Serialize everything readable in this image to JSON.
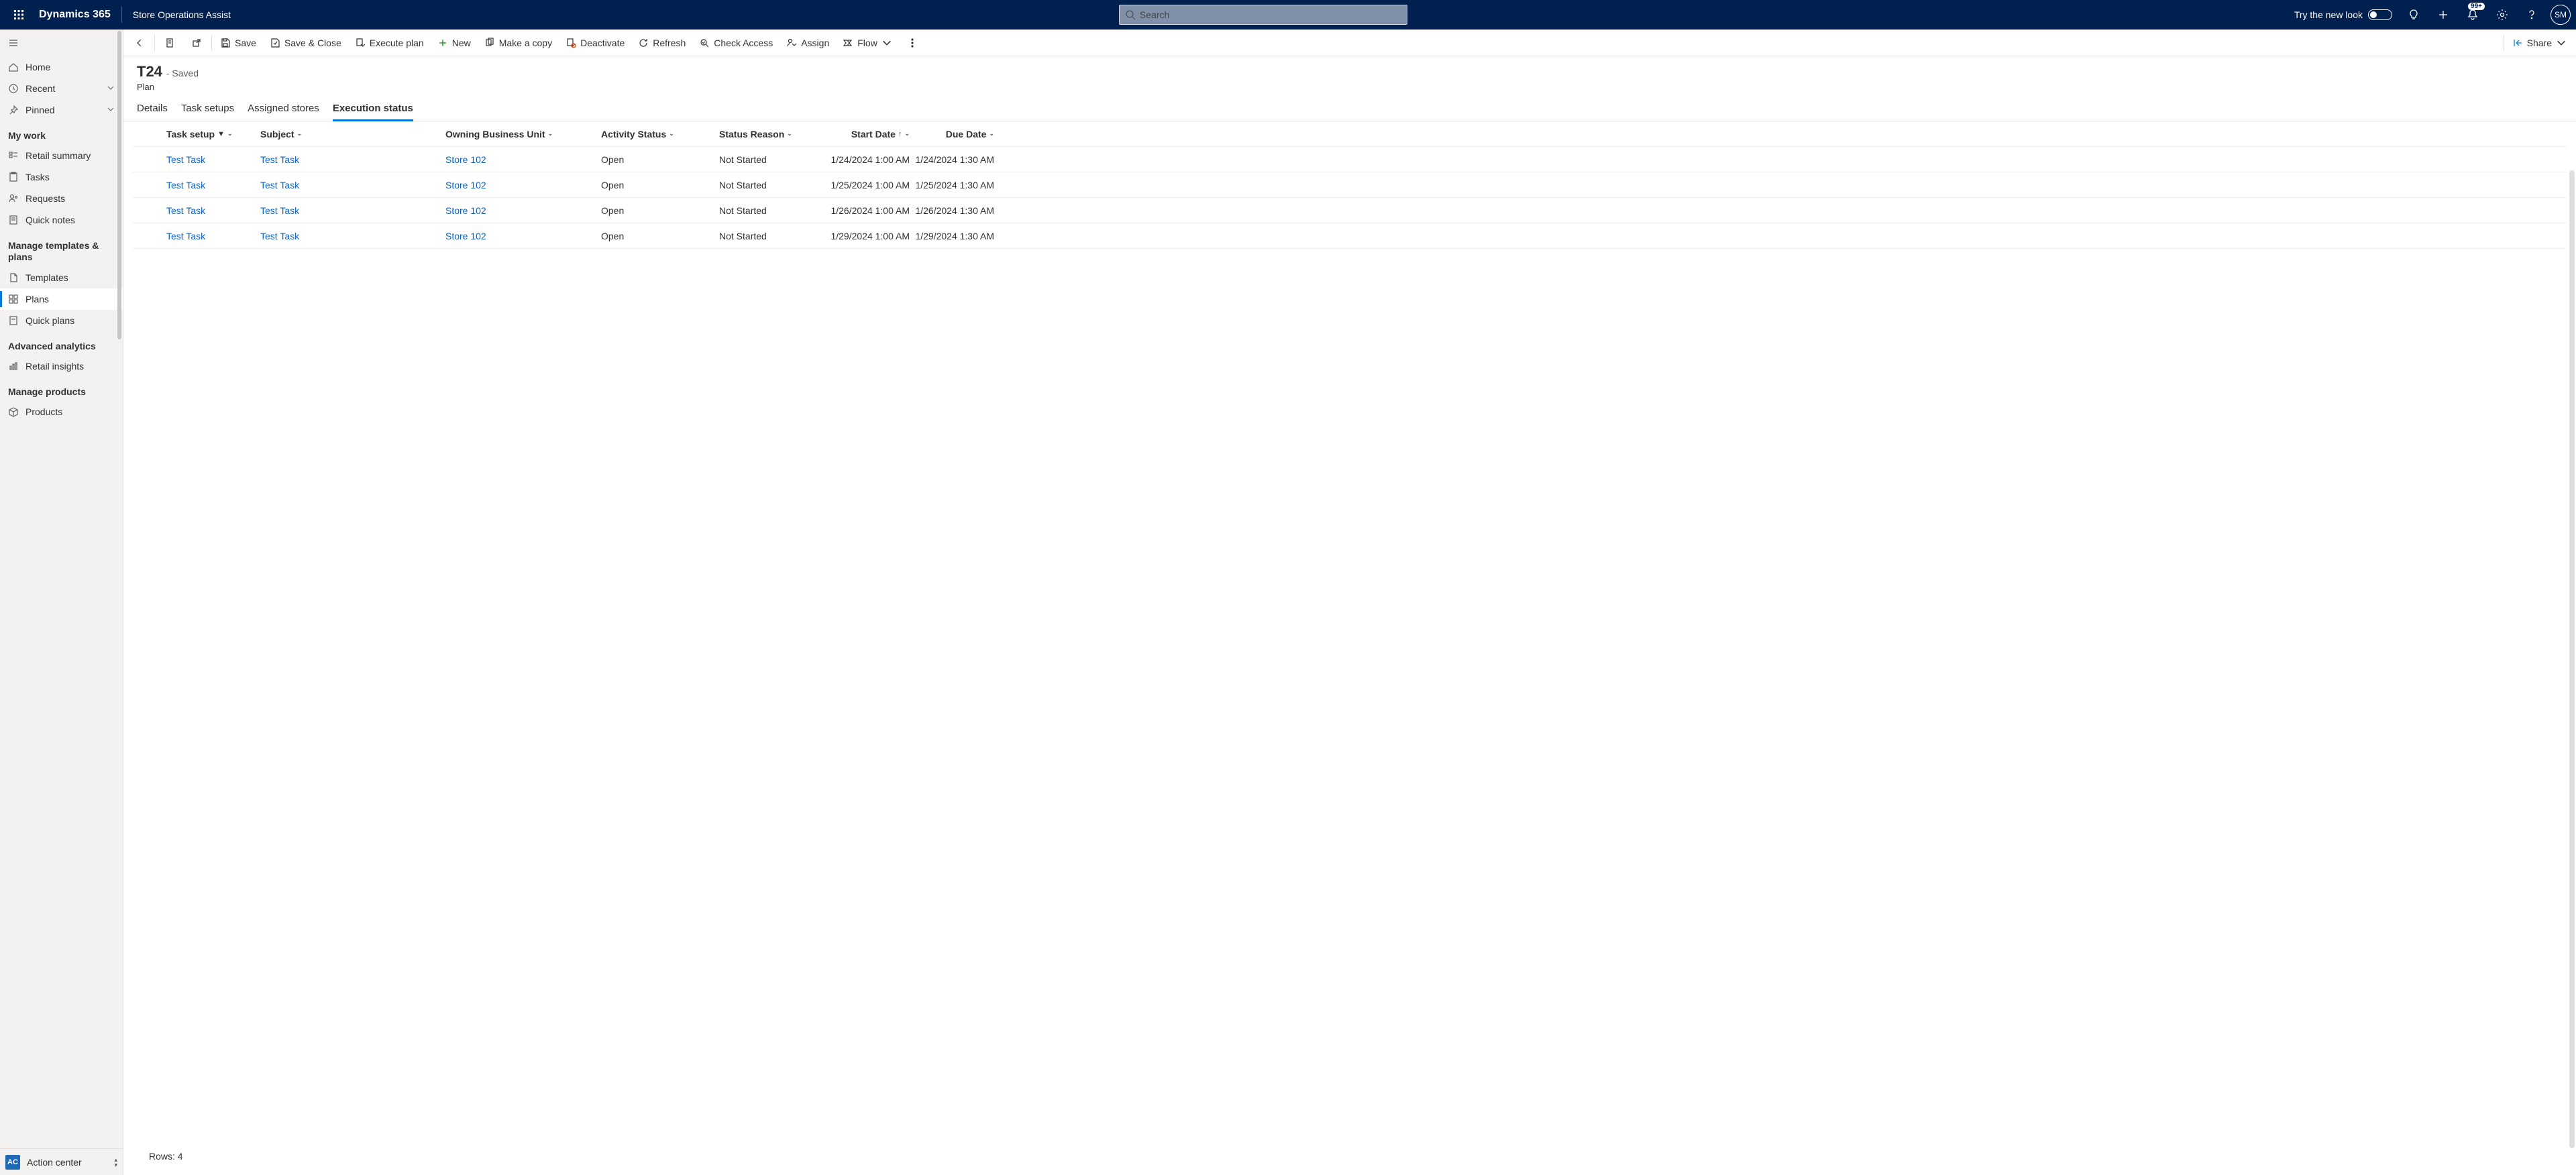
{
  "header": {
    "app_title": "Dynamics 365",
    "area_title": "Store Operations Assist",
    "search_placeholder": "Search",
    "try_new_look": "Try the new look",
    "notification_badge": "99+",
    "avatar_initials": "SM"
  },
  "sidebar": {
    "home": "Home",
    "recent": "Recent",
    "pinned": "Pinned",
    "sections": {
      "my_work": "My work",
      "manage_templates": "Manage templates & plans",
      "advanced_analytics": "Advanced analytics",
      "manage_products": "Manage products"
    },
    "items": {
      "retail_summary": "Retail summary",
      "tasks": "Tasks",
      "requests": "Requests",
      "quick_notes": "Quick notes",
      "templates": "Templates",
      "plans": "Plans",
      "quick_plans": "Quick plans",
      "retail_insights": "Retail insights",
      "products": "Products"
    },
    "action_center": {
      "badge": "AC",
      "label": "Action center"
    }
  },
  "commands": {
    "save": "Save",
    "save_close": "Save & Close",
    "execute_plan": "Execute plan",
    "new": "New",
    "make_copy": "Make a copy",
    "deactivate": "Deactivate",
    "refresh": "Refresh",
    "check_access": "Check Access",
    "assign": "Assign",
    "flow": "Flow",
    "share": "Share"
  },
  "page": {
    "title": "T24",
    "saved_suffix": "- Saved",
    "subtitle": "Plan"
  },
  "tabs": {
    "details": "Details",
    "task_setups": "Task setups",
    "assigned_stores": "Assigned stores",
    "execution_status": "Execution status"
  },
  "grid": {
    "columns": {
      "task_setup": "Task setup",
      "subject": "Subject",
      "owning_bu": "Owning Business Unit",
      "activity_status": "Activity Status",
      "status_reason": "Status Reason",
      "start_date": "Start Date",
      "due_date": "Due Date"
    },
    "rows": [
      {
        "task_setup": "Test Task",
        "subject": "Test Task",
        "bu": "Store 102",
        "activity": "Open",
        "reason": "Not Started",
        "start": "1/24/2024 1:00 AM",
        "due": "1/24/2024 1:30 AM"
      },
      {
        "task_setup": "Test Task",
        "subject": "Test Task",
        "bu": "Store 102",
        "activity": "Open",
        "reason": "Not Started",
        "start": "1/25/2024 1:00 AM",
        "due": "1/25/2024 1:30 AM"
      },
      {
        "task_setup": "Test Task",
        "subject": "Test Task",
        "bu": "Store 102",
        "activity": "Open",
        "reason": "Not Started",
        "start": "1/26/2024 1:00 AM",
        "due": "1/26/2024 1:30 AM"
      },
      {
        "task_setup": "Test Task",
        "subject": "Test Task",
        "bu": "Store 102",
        "activity": "Open",
        "reason": "Not Started",
        "start": "1/29/2024 1:00 AM",
        "due": "1/29/2024 1:30 AM"
      }
    ],
    "footer": "Rows: 4"
  }
}
